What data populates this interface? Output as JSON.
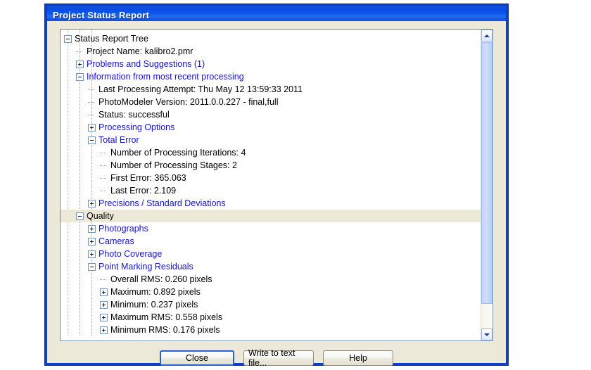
{
  "window": {
    "title": "Project Status Report"
  },
  "tree": {
    "rows": [
      {
        "level": 0,
        "marker": "minus",
        "link": false,
        "selected": false,
        "label": "Status Report Tree"
      },
      {
        "level": 1,
        "marker": "leaf",
        "link": false,
        "selected": false,
        "label": "Project Name: kalibro2.pmr"
      },
      {
        "level": 1,
        "marker": "plus",
        "link": true,
        "selected": false,
        "label": "Problems and Suggestions (1)"
      },
      {
        "level": 1,
        "marker": "minus",
        "link": true,
        "selected": false,
        "label": "Information from most recent processing"
      },
      {
        "level": 2,
        "marker": "leaf",
        "link": false,
        "selected": false,
        "label": "Last Processing Attempt: Thu May 12 13:59:33 2011"
      },
      {
        "level": 2,
        "marker": "leaf",
        "link": false,
        "selected": false,
        "label": "PhotoModeler Version: 2011.0.0.227 - final,full"
      },
      {
        "level": 2,
        "marker": "leaf",
        "link": false,
        "selected": false,
        "label": "Status: successful"
      },
      {
        "level": 2,
        "marker": "plus",
        "link": true,
        "selected": false,
        "label": "Processing Options"
      },
      {
        "level": 2,
        "marker": "minus",
        "link": true,
        "selected": false,
        "label": "Total Error"
      },
      {
        "level": 3,
        "marker": "leaf",
        "link": false,
        "selected": false,
        "label": "Number of Processing Iterations: 4"
      },
      {
        "level": 3,
        "marker": "leaf",
        "link": false,
        "selected": false,
        "label": "Number of Processing Stages: 2"
      },
      {
        "level": 3,
        "marker": "leaf",
        "link": false,
        "selected": false,
        "label": "First Error: 365.063"
      },
      {
        "level": 3,
        "marker": "leaf",
        "link": false,
        "selected": false,
        "label": "Last Error: 2.109"
      },
      {
        "level": 2,
        "marker": "plus",
        "link": true,
        "selected": false,
        "label": "Precisions / Standard Deviations"
      },
      {
        "level": 1,
        "marker": "minus",
        "link": false,
        "selected": true,
        "label": "Quality"
      },
      {
        "level": 2,
        "marker": "plus",
        "link": true,
        "selected": false,
        "label": "Photographs"
      },
      {
        "level": 2,
        "marker": "plus",
        "link": true,
        "selected": false,
        "label": "Cameras"
      },
      {
        "level": 2,
        "marker": "plus",
        "link": true,
        "selected": false,
        "label": "Photo Coverage"
      },
      {
        "level": 2,
        "marker": "minus",
        "link": true,
        "selected": false,
        "label": "Point Marking Residuals"
      },
      {
        "level": 3,
        "marker": "leaf",
        "link": false,
        "selected": false,
        "label": "Overall RMS: 0.260 pixels"
      },
      {
        "level": 3,
        "marker": "plus",
        "link": false,
        "selected": false,
        "label": "Maximum: 0.892 pixels"
      },
      {
        "level": 3,
        "marker": "plus",
        "link": false,
        "selected": false,
        "label": "Minimum: 0.237 pixels"
      },
      {
        "level": 3,
        "marker": "plus",
        "link": false,
        "selected": false,
        "label": "Maximum RMS: 0.558 pixels"
      },
      {
        "level": 3,
        "marker": "plus",
        "link": false,
        "selected": false,
        "label": "Minimum RMS: 0.176 pixels"
      }
    ],
    "guides": [
      {
        "level": 1
      },
      {
        "level": 2
      },
      {
        "level": 3
      }
    ]
  },
  "scrollbar": {
    "up_arrow": "scroll-up-arrow",
    "down_arrow": "scroll-down-arrow"
  },
  "buttons": {
    "close": "Close",
    "write": "Write to text file...",
    "help": "Help"
  },
  "colors": {
    "title_bar": "#0a55ea",
    "link_text": "#1414cc",
    "selection": "#ece9d8",
    "dialog_face": "#ece9d8",
    "border": "#0b3fc8"
  }
}
